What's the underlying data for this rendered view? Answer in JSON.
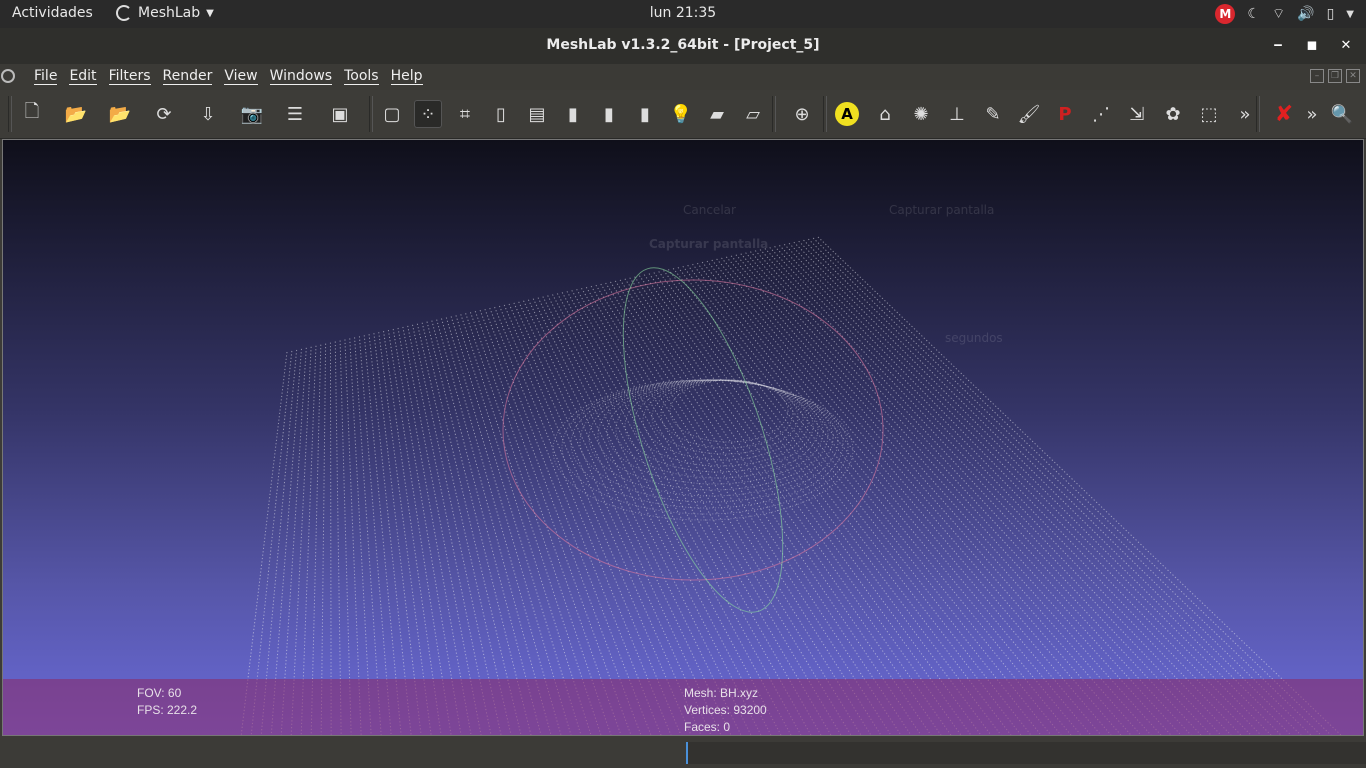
{
  "topbar": {
    "activities": "Actividades",
    "app_name": "MeshLab",
    "clock": "lun 21:35",
    "mega_letter": "M"
  },
  "window": {
    "title": "MeshLab v1.3.2_64bit - [Project_5]"
  },
  "menu": {
    "items": [
      "File",
      "Edit",
      "Filters",
      "Render",
      "View",
      "Windows",
      "Tools",
      "Help"
    ]
  },
  "toolbar": {
    "buttons": [
      {
        "name": "new-project-icon",
        "glyph": "🗋"
      },
      {
        "name": "open-project-icon",
        "glyph": "📂"
      },
      {
        "name": "import-mesh-icon",
        "glyph": "📂"
      },
      {
        "name": "reload-icon",
        "glyph": "⟳"
      },
      {
        "name": "export-mesh-icon",
        "glyph": "⇩"
      },
      {
        "name": "snapshot-icon",
        "glyph": "📷"
      },
      {
        "name": "layers-icon",
        "glyph": "☰"
      },
      {
        "name": "raster-icon",
        "glyph": "▣"
      },
      {
        "name": "bounding-box-icon",
        "glyph": "▢"
      },
      {
        "name": "points-icon",
        "glyph": "⁘"
      },
      {
        "name": "wireframe-icon",
        "glyph": "⌗"
      },
      {
        "name": "hidden-lines-icon",
        "glyph": "▯"
      },
      {
        "name": "flat-lines-icon",
        "glyph": "▤"
      },
      {
        "name": "flat-icon",
        "glyph": "▮"
      },
      {
        "name": "smooth-icon",
        "glyph": "▮"
      },
      {
        "name": "texture-icon",
        "glyph": "▮"
      },
      {
        "name": "light-icon",
        "glyph": "💡"
      },
      {
        "name": "backface-icon",
        "glyph": "▰"
      },
      {
        "name": "cull-icon",
        "glyph": "▱"
      },
      {
        "name": "trackball-icon",
        "glyph": "⊕"
      },
      {
        "name": "annotate-icon",
        "glyph": "A"
      },
      {
        "name": "measure-icon",
        "glyph": "⌂"
      },
      {
        "name": "select-vertices-icon",
        "glyph": "✺"
      },
      {
        "name": "align-icon",
        "glyph": "⊥"
      },
      {
        "name": "paint-icon",
        "glyph": "✎"
      },
      {
        "name": "brush-icon",
        "glyph": "🖌"
      },
      {
        "name": "pickpoints-icon",
        "glyph": "P"
      },
      {
        "name": "select-faces-icon",
        "glyph": "⋰"
      },
      {
        "name": "manipulator-icon",
        "glyph": "⇲"
      },
      {
        "name": "color-icon",
        "glyph": "✿"
      },
      {
        "name": "select-region-icon",
        "glyph": "⬚"
      }
    ],
    "more_1": "»",
    "delete_glyph": "✘",
    "more_2": "»",
    "search_glyph": "🔍"
  },
  "ghost_dialog": {
    "cancel": "Cancelar",
    "capture_button": "Capturar pantalla",
    "capture_title": "Capturar pantalla",
    "seconds": "segundos"
  },
  "viewport_info": {
    "fov": "FOV: 60",
    "fps": "FPS:   222.2",
    "mesh": "Mesh: BH.xyz",
    "vertices": "Vertices: 93200",
    "faces": "Faces: 0"
  },
  "colors": {
    "accent": "#4a90d9",
    "mega": "#d9272e",
    "info_bar": "#8c2864"
  }
}
